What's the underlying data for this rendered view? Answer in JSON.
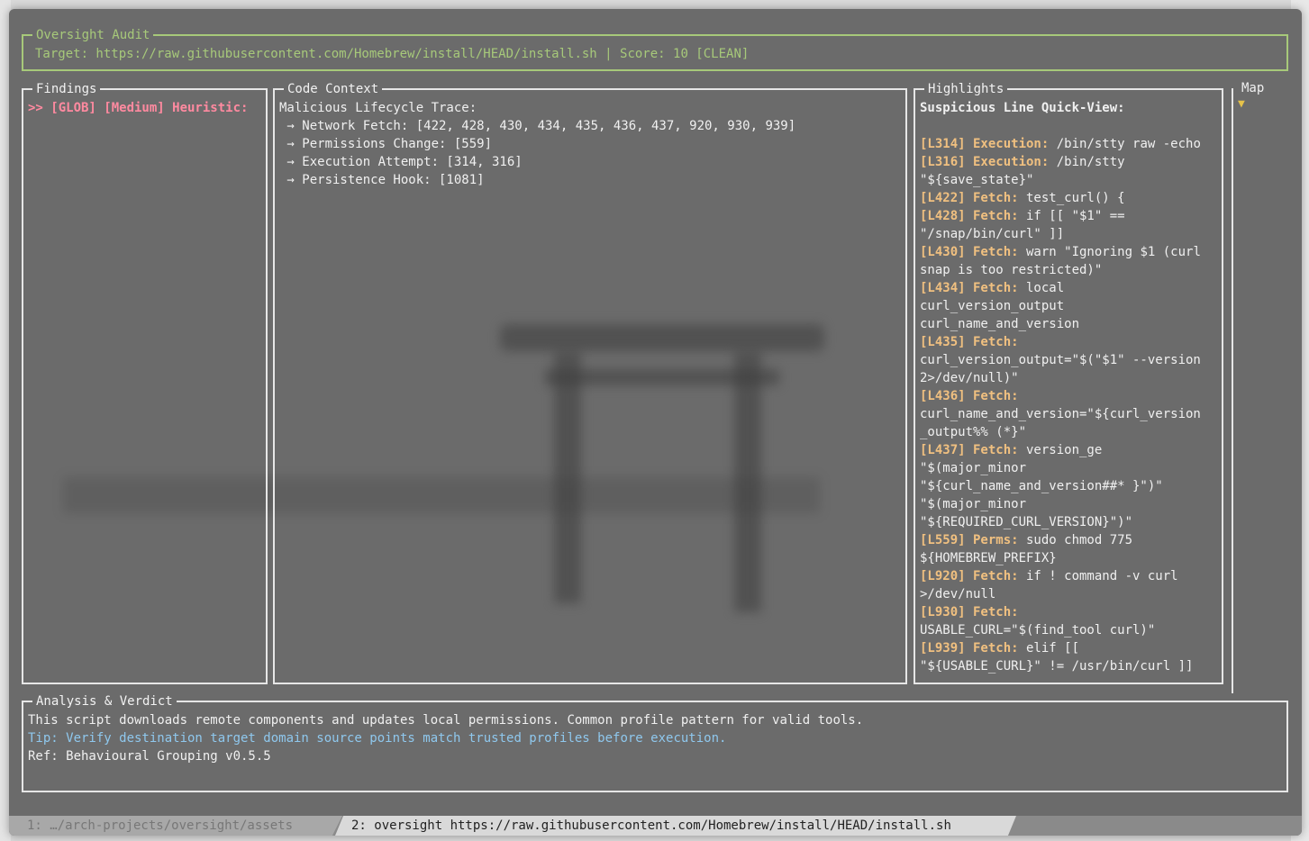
{
  "header": {
    "title": "Oversight Audit",
    "target_line": "Target: https://raw.githubusercontent.com/Homebrew/install/HEAD/install.sh | Score: 10 [CLEAN]"
  },
  "findings": {
    "title": "Findings",
    "items": [
      ">> [GLOB] [Medium] Heuristic:"
    ]
  },
  "code_context": {
    "title": "Code Context",
    "heading": "Malicious Lifecycle Trace:",
    "traces": [
      " → Network Fetch: [422, 428, 430, 434, 435, 436, 437, 920, 930, 939]",
      " → Permissions Change: [559]",
      " → Execution Attempt: [314, 316]",
      " → Persistence Hook: [1081]"
    ]
  },
  "highlights": {
    "title": "Highlights",
    "heading": "Suspicious Line Quick-View:",
    "entries": [
      {
        "ref": "[L314] Execution:",
        "lines": [
          " /bin/stty raw -echo"
        ]
      },
      {
        "ref": "[L316] Execution:",
        "lines": [
          " /bin/stty",
          "\"${save_state}\""
        ]
      },
      {
        "ref": "[L422] Fetch:",
        "lines": [
          " test_curl() {"
        ]
      },
      {
        "ref": "[L428] Fetch:",
        "lines": [
          " if [[ \"$1\" ==",
          "\"/snap/bin/curl\" ]]"
        ]
      },
      {
        "ref": "[L430] Fetch:",
        "lines": [
          " warn \"Ignoring $1 (curl",
          "snap is too restricted)\""
        ]
      },
      {
        "ref": "[L434] Fetch:",
        "lines": [
          " local",
          "curl_version_output",
          "curl_name_and_version"
        ]
      },
      {
        "ref": "[L435] Fetch:",
        "lines": [
          "",
          "curl_version_output=\"$(\"$1\" --version",
          "2>/dev/null)\""
        ]
      },
      {
        "ref": "[L436] Fetch:",
        "lines": [
          "",
          "curl_name_and_version=\"${curl_version",
          "_output%% (*}\""
        ]
      },
      {
        "ref": "[L437] Fetch:",
        "lines": [
          " version_ge",
          "\"$(major_minor",
          "\"${curl_name_and_version##* }\")\"",
          "\"$(major_minor",
          "\"${REQUIRED_CURL_VERSION}\")\""
        ]
      },
      {
        "ref": "[L559] Perms:",
        "lines": [
          " sudo chmod 775",
          "${HOMEBREW_PREFIX}"
        ]
      },
      {
        "ref": "[L920] Fetch:",
        "lines": [
          " if ! command -v curl",
          ">/dev/null"
        ]
      },
      {
        "ref": "[L930] Fetch:",
        "lines": [
          "",
          "USABLE_CURL=\"$(find_tool curl)\""
        ]
      },
      {
        "ref": "[L939] Fetch:",
        "lines": [
          " elif [[",
          "\"${USABLE_CURL}\" != /usr/bin/curl ]]"
        ]
      }
    ]
  },
  "map": {
    "title": "Map",
    "marker": "▼"
  },
  "verdict": {
    "title": "Analysis & Verdict",
    "summary": "This script downloads remote components and updates local permissions. Common profile pattern for valid tools.",
    "tip": "Tip: Verify destination target domain source points match trusted profiles before execution.",
    "ref": "Ref: Behavioural Grouping v0.5.5"
  },
  "tabs": [
    {
      "label": "1: …/arch-projects/oversight/assets"
    },
    {
      "label": "2: oversight https://raw.githubusercontent.com/Homebrew/install/HEAD/install.sh"
    }
  ],
  "colors": {
    "header": "#a7c97a",
    "finding": "#ff8aa0",
    "highlight_ref": "#f0c080",
    "tip": "#8fc8ee"
  }
}
